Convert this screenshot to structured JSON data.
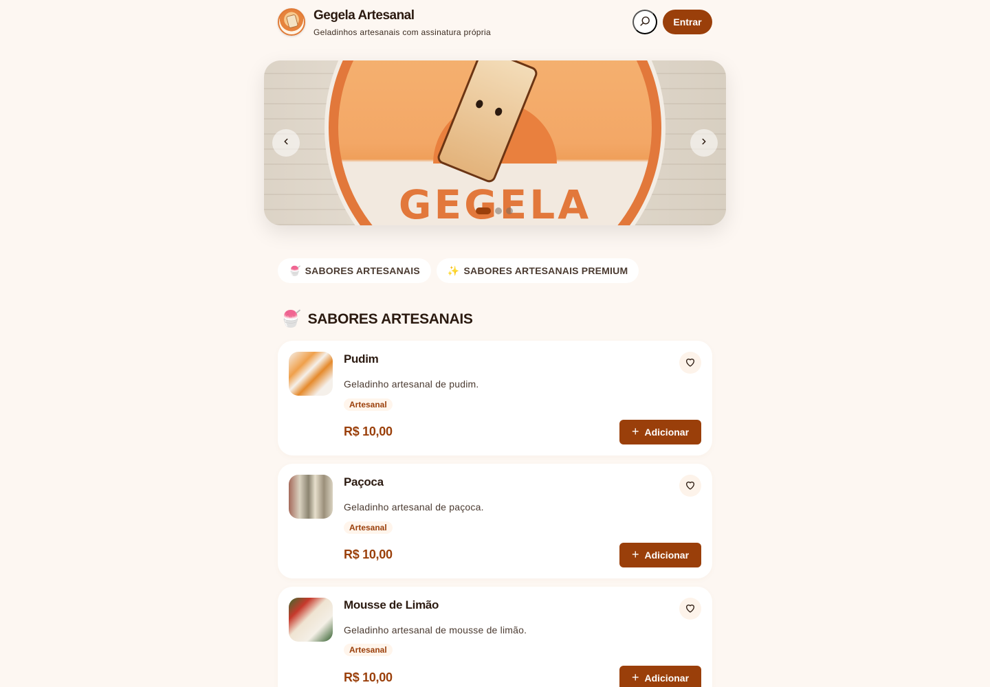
{
  "header": {
    "title": "Gegela Artesanal",
    "subtitle": "Geladinhos artesanais com assinatura própria",
    "login_label": "Entrar",
    "logo_icon": "gegela-logo",
    "search_icon": "search-icon"
  },
  "banner": {
    "text": "GEGELA",
    "prev_icon": "chevron-left-icon",
    "next_icon": "chevron-right-icon",
    "slides": 3,
    "active_slide": 1
  },
  "categories": [
    {
      "emoji": "🍧",
      "label": "SABORES ARTESANAIS"
    },
    {
      "emoji": "✨",
      "label": "SABORES ARTESANAIS PREMIUM"
    }
  ],
  "section": {
    "emoji": "🍧",
    "title": "SABORES ARTESANAIS"
  },
  "products": [
    {
      "name": "Pudim",
      "description": "Geladinho artesanal de pudim.",
      "tag": "Artesanal",
      "price": "R$ 10,00",
      "add_label": "Adicionar"
    },
    {
      "name": "Paçoca",
      "description": "Geladinho artesanal de paçoca.",
      "tag": "Artesanal",
      "price": "R$ 10,00",
      "add_label": "Adicionar"
    },
    {
      "name": "Mousse de Limão",
      "description": "Geladinho artesanal de mousse de limão.",
      "tag": "Artesanal",
      "price": "R$ 10,00",
      "add_label": "Adicionar"
    }
  ],
  "colors": {
    "accent": "#9a3f0a",
    "background": "#fdf7f2",
    "banner_orange": "#e2783b"
  }
}
